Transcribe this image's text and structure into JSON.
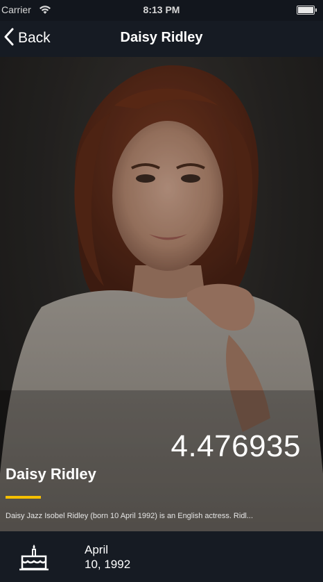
{
  "status_bar": {
    "carrier": "Carrier",
    "time": "8:13 PM",
    "icons": [
      "wifi-icon",
      "battery-icon"
    ]
  },
  "nav": {
    "back_label": "Back",
    "back_icon": "chevron-left-icon",
    "title": "Daisy Ridley"
  },
  "hero": {
    "image": "portrait-photo",
    "score": "4.476935",
    "name": "Daisy Ridley",
    "accent_color": "#f5c000",
    "bio": "Daisy Jazz Isobel Ridley (born 10 April 1992) is an English actress. Ridl..."
  },
  "details": {
    "birthday_icon": "birthday-cake-icon",
    "birthday_month": "April",
    "birthday_rest": "10, 1992"
  },
  "colors": {
    "background": "#161b23",
    "accent": "#f5c000",
    "text": "#ffffff"
  }
}
